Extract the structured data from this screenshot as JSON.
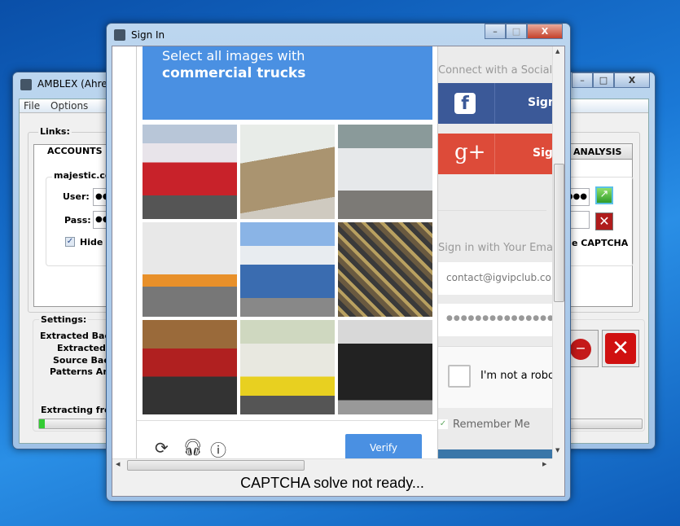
{
  "back_window": {
    "title": "AMBLEX (Ahrefs",
    "menu": [
      "File",
      "Options"
    ],
    "links_label": "Links:",
    "tab_accounts": "ACCOUNTS",
    "tab_analysis": "ANALYSIS",
    "group_label": "majestic.con",
    "user_label": "User:",
    "pass_label": "Pass:",
    "user_value": "●●",
    "pass_value": "●●",
    "right_pass_value": "●●●",
    "hide_checkbox_label": "Hide c",
    "hide_checked": true,
    "captcha_checkbox_label": "e CAPTCHA",
    "settings_label": "Settings:",
    "settings_items": [
      "Extracted Backl",
      "Extracted L",
      "Source Backl",
      "Patterns Ana"
    ],
    "extracting_label": "Extracting from",
    "progress_percent": 1
  },
  "signin_window": {
    "title": "Sign In",
    "captcha": {
      "instruction_line1": "Select all images with",
      "instruction_line2": "commercial trucks",
      "tiles": [
        "red truck",
        "boat deck",
        "white car",
        "kayak",
        "blue trucks",
        "bicycles",
        "motorcycle",
        "tanker truck",
        "black car"
      ],
      "verify_label": "Verify",
      "icons": [
        "reload-icon",
        "audio-icon",
        "info-icon"
      ]
    },
    "page": {
      "social_heading": "Connect with a Social N",
      "facebook_label": "Sign",
      "google_label": "Sig",
      "email_heading": "Sign in with Your Email",
      "email_value": "contact@igvipclub.cor",
      "password_value": "●●●●●●●●●●●●●●●●",
      "recaptcha_label": "I'm not a robot",
      "remember_label": "Remember Me",
      "remember_checked": true
    },
    "status": "CAPTCHA solve not ready...",
    "colors": {
      "facebook": "#3b5998",
      "google": "#dd4b39",
      "captcha_blue": "#4a90e2"
    }
  }
}
